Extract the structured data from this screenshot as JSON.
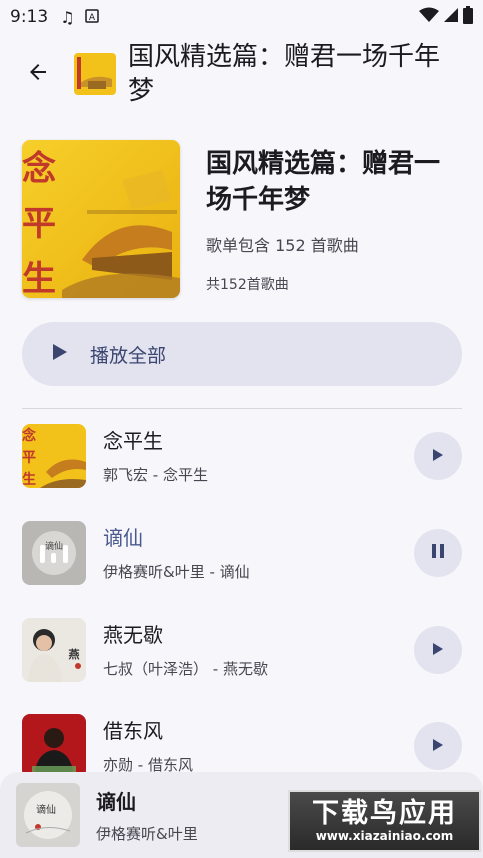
{
  "status_bar": {
    "time": "9:13"
  },
  "top_bar": {
    "title": "国风精选篇：赠君一场千年梦"
  },
  "header": {
    "title": "国风精选篇：赠君一场千年梦",
    "description": "歌单包含 152 首歌曲",
    "count": "共152首歌曲",
    "cover_text": "念平生"
  },
  "play_all": {
    "label": "播放全部"
  },
  "songs": [
    {
      "title": "念平生",
      "subtitle": "郭飞宏 - 念平生",
      "state": "play"
    },
    {
      "title": "谪仙",
      "subtitle": "伊格赛听&叶里 - 谪仙",
      "state": "pause"
    },
    {
      "title": "燕无歇",
      "subtitle": "七叔（叶泽浩） - 燕无歇",
      "state": "play"
    },
    {
      "title": "借东风",
      "subtitle": "亦勋 - 借东风",
      "state": "play"
    }
  ],
  "mini_player": {
    "title": "谪仙",
    "artist": "伊格赛听&叶里"
  },
  "watermark": {
    "main": "下载鸟应用",
    "sub": "www.xiazainiao.com"
  },
  "colors": {
    "accent": "#4a5a8e",
    "chip": "#e3e3ef",
    "background": "#f7f6fb",
    "cover_yellow": "#f2c21b"
  }
}
